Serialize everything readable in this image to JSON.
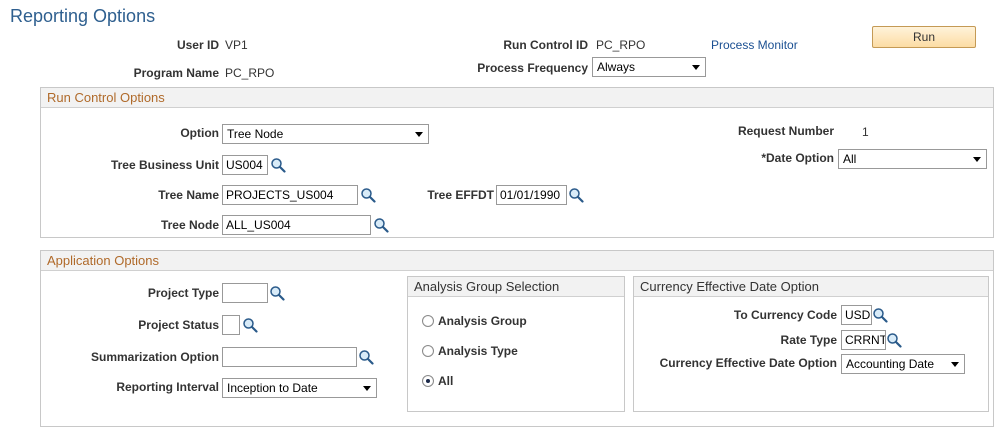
{
  "page": {
    "title": "Reporting Options"
  },
  "header": {
    "user_id_label": "User ID",
    "user_id_value": "VP1",
    "program_name_label": "Program Name",
    "program_name_value": "PC_RPO",
    "run_control_id_label": "Run Control ID",
    "run_control_id_value": "PC_RPO",
    "process_monitor_link": "Process Monitor",
    "run_button": "Run",
    "process_frequency_label": "Process Frequency",
    "process_frequency_value": "Always"
  },
  "run_control_options": {
    "title": "Run Control Options",
    "option_label": "Option",
    "option_value": "Tree Node",
    "request_number_label": "Request Number",
    "request_number_value": "1",
    "tree_business_unit_label": "Tree Business Unit",
    "tree_business_unit_value": "US004",
    "date_option_label": "*Date Option",
    "date_option_value": "All",
    "tree_name_label": "Tree Name",
    "tree_name_value": "PROJECTS_US004",
    "tree_effdt_label": "Tree EFFDT",
    "tree_effdt_value": "01/01/1990",
    "tree_node_label": "Tree Node",
    "tree_node_value": "ALL_US004"
  },
  "application_options": {
    "title": "Application Options",
    "project_type_label": "Project Type",
    "project_type_value": "",
    "project_status_label": "Project Status",
    "project_status_value": "",
    "summarization_option_label": "Summarization Option",
    "summarization_option_value": "",
    "reporting_interval_label": "Reporting Interval",
    "reporting_interval_value": "Inception to Date"
  },
  "analysis_group_selection": {
    "title": "Analysis Group Selection",
    "options": [
      {
        "label": "Analysis Group",
        "checked": false
      },
      {
        "label": "Analysis Type",
        "checked": false
      },
      {
        "label": "All",
        "checked": true
      }
    ]
  },
  "currency_effective_date_option": {
    "title": "Currency Effective Date Option",
    "to_currency_code_label": "To Currency Code",
    "to_currency_code_value": "USD",
    "rate_type_label": "Rate Type",
    "rate_type_value": "CRRNT",
    "currency_effective_date_option_label": "Currency Effective Date Option",
    "currency_effective_date_option_value": "Accounting Date"
  },
  "icons": {
    "lookup": "magnifier-lookup-icon",
    "dropdown": "chevron-down-icon"
  },
  "colors": {
    "title": "#2e5f8f",
    "group_header_text": "#b06a2a",
    "link": "#1a4f92",
    "run_button": "#fcdca4"
  }
}
